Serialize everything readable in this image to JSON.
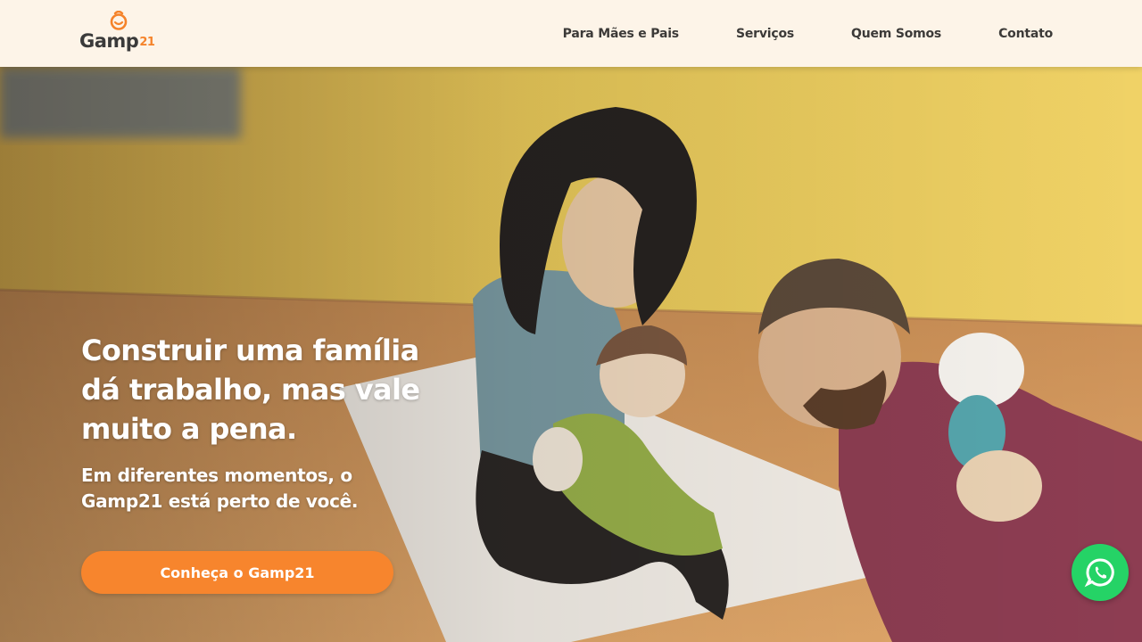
{
  "brand": {
    "name": "Gamp",
    "suffix": "21",
    "colors": {
      "accent": "#f5832a",
      "header_bg": "#fdf4e8",
      "text_dark": "#3c3a38",
      "whatsapp": "#25d366"
    }
  },
  "nav": {
    "items": [
      {
        "label": "Para Mães e Pais"
      },
      {
        "label": "Serviços"
      },
      {
        "label": "Quem Somos"
      },
      {
        "label": "Contato"
      }
    ]
  },
  "hero": {
    "headline": "Construir uma família dá trabalho, mas vale muito a pena.",
    "subheadline": "Em diferentes momentos, o Gamp21 está perto de você.",
    "cta_label": "Conheça o Gamp21"
  },
  "icons": {
    "logo": "gamp21-logo-mark",
    "floating": "whatsapp-icon"
  }
}
